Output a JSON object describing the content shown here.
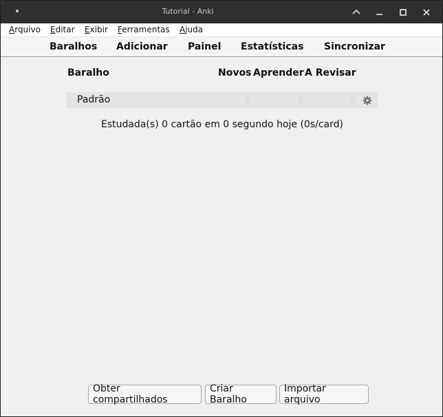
{
  "window": {
    "title": "Tutorial - Anki"
  },
  "menu": [
    "Arquivo",
    "Editar",
    "Exibir",
    "Ferramentas",
    "Ajuda"
  ],
  "toolbar": {
    "decks": "Baralhos",
    "add": "Adicionar",
    "browse": "Painel",
    "stats": "Estatísticas",
    "sync": "Sincronizar"
  },
  "deck_table": {
    "headers": {
      "deck": "Baralho",
      "new": "Novos",
      "learn": "Aprender",
      "review": "A Revisar"
    },
    "rows": [
      {
        "name": "Padrão",
        "new": "0",
        "learn": "0",
        "review": "0"
      }
    ]
  },
  "studied_text": "Estudada(s) 0 cartão em 0 segundo hoje (0s/card)",
  "buttons": {
    "shared": "Obter compartilhados",
    "create": "Criar Baralho",
    "import": "Importar arquivo"
  },
  "colors": {
    "titlebar": "#2f2f2f",
    "background": "#f0f0f0",
    "row": "#e4e4e4"
  }
}
